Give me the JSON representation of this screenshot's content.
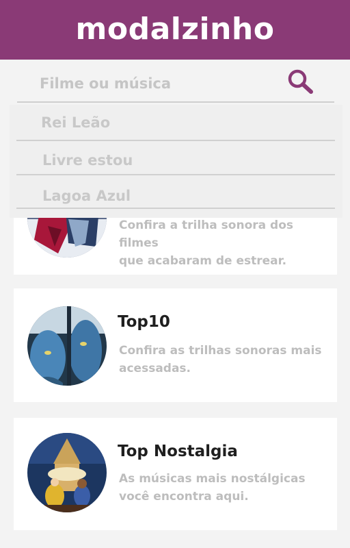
{
  "header": {
    "title": "modalzinho",
    "color": "#8a3a76"
  },
  "search": {
    "placeholder": "Filme ou música",
    "value": ""
  },
  "suggestions": [
    {
      "label": "Rei Leão"
    },
    {
      "label": "Livre estou"
    },
    {
      "label": "Lagoa Azul"
    }
  ],
  "cards": [
    {
      "title": "",
      "description_line1": "Confira a trilha sonora dos filmes",
      "description_line2": "que acabaram de estrear."
    },
    {
      "title": "Top10",
      "description_line1": "Confira as trilhas sonoras mais",
      "description_line2": "acessadas."
    },
    {
      "title": "Top Nostalgia",
      "description_line1": "As músicas mais nostálgicas",
      "description_line2": "você encontra aqui."
    }
  ]
}
